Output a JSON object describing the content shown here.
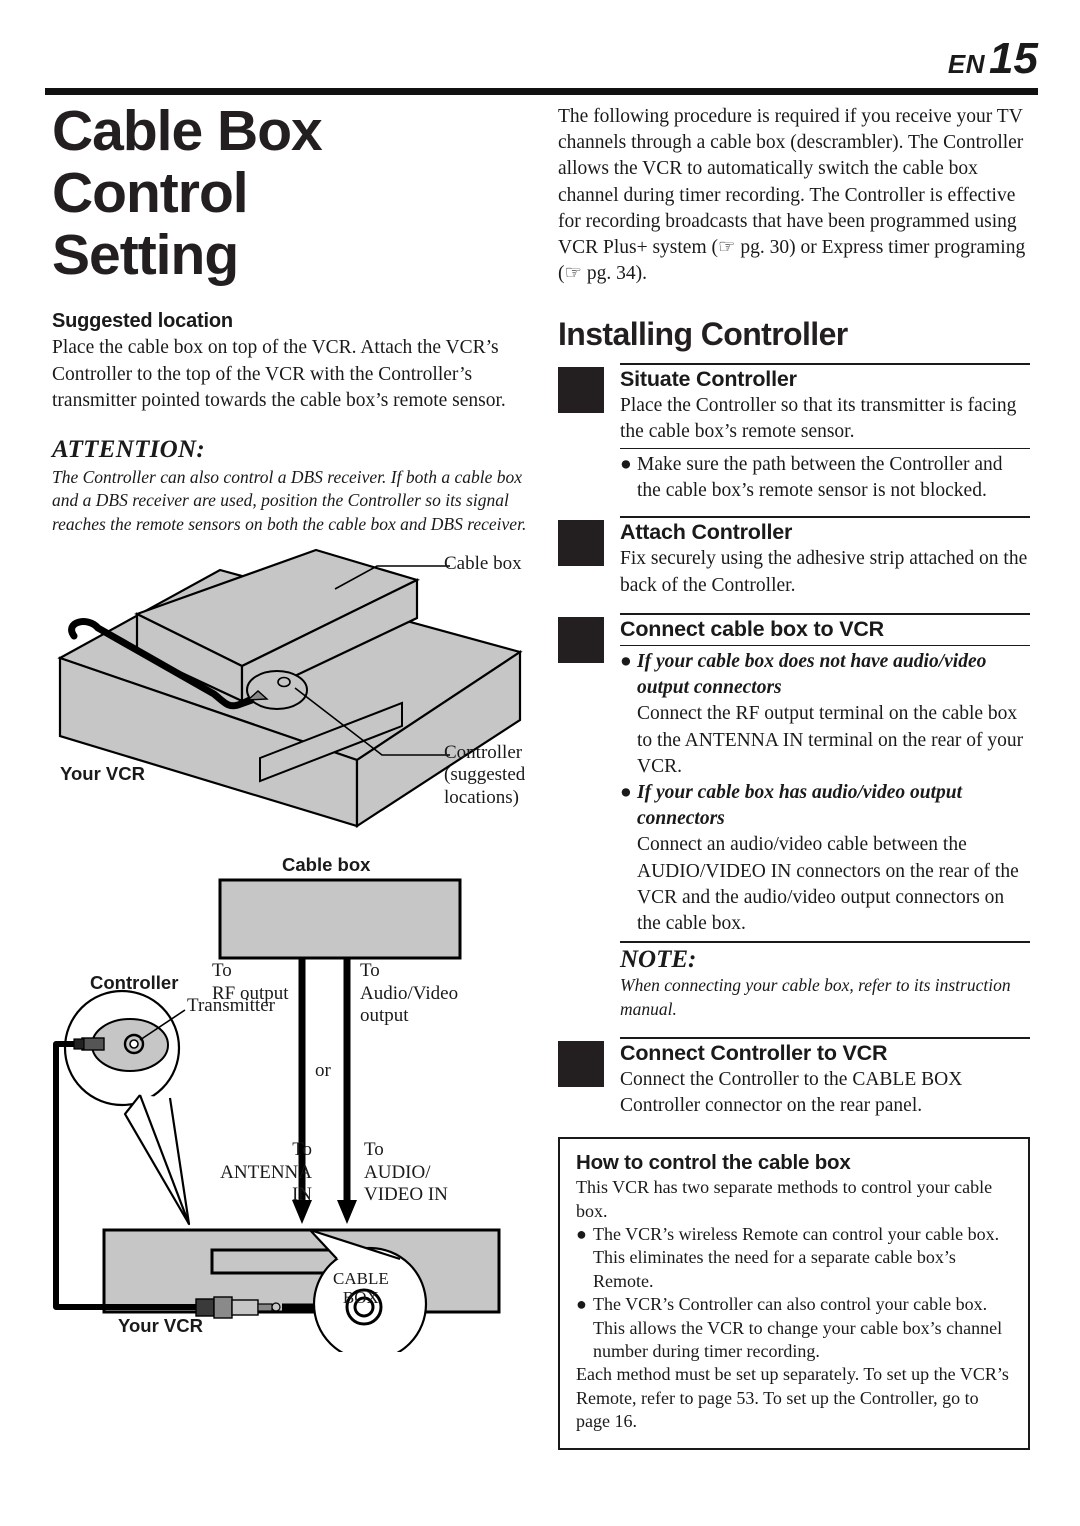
{
  "header": {
    "lang_code": "EN",
    "page_number": "15"
  },
  "left": {
    "title": "Cable Box Control Setting",
    "suggested_location": {
      "heading": "Suggested location",
      "body": "Place the cable box on top of the VCR. Attach the VCR’s Controller to the top of the VCR with the Controller’s transmitter pointed towards the cable box’s remote sensor."
    },
    "attention": {
      "heading": "ATTENTION:",
      "body": "The Controller can also control a DBS receiver. If both a cable box and a DBS receiver are used, position the Controller so its signal reaches the remote sensors on both the cable box and DBS receiver."
    },
    "figure_iso": {
      "label_cable_box": "Cable box",
      "label_controller_line1": "Controller",
      "label_controller_line2": "(suggested",
      "label_controller_line3": "locations)",
      "label_your_vcr": "Your VCR"
    },
    "figure_wiring": {
      "label_cable_box": "Cable box",
      "label_controller": "Controller",
      "label_transmitter": "Transmitter",
      "label_to_rf_1": "To",
      "label_to_rf_2": "RF output",
      "label_to_av_1": "To",
      "label_to_av_2": "Audio/Video",
      "label_to_av_3": "output",
      "label_or": "or",
      "label_to_ant_1": "To",
      "label_to_ant_2": "ANTENNA",
      "label_to_ant_3": "IN",
      "label_to_avin_1": "To",
      "label_to_avin_2": "AUDIO/",
      "label_to_avin_3": "VIDEO IN",
      "label_your_vcr": "Your VCR",
      "label_jack_1": "CABLE",
      "label_jack_2": "BOX"
    }
  },
  "right": {
    "intro": "The following procedure is required if you receive your TV channels through a cable box (descrambler). The Controller allows the VCR to automatically switch the cable box channel during timer recording. The Controller is effective for recording broadcasts that have been programmed using VCR Plus+ system (☞ pg. 30) or Express timer programing (☞ pg. 34).",
    "section_title": "Installing Controller",
    "steps": [
      {
        "head": "Situate Controller",
        "body": "Place the Controller so that its transmitter is facing the cable box’s remote sensor.",
        "bullets": [
          "Make sure the path between the Controller and the cable box’s remote sensor is not blocked."
        ]
      },
      {
        "head": "Attach Controller",
        "body": "Fix securely using the adhesive strip attached on the back of the Controller.",
        "bullets": []
      },
      {
        "head": "Connect cable box to VCR",
        "sub_a_head": "If your cable box does not have audio/video output connectors",
        "sub_a_body": "Connect the RF output terminal on the cable box to the ANTENNA IN terminal on the rear of your VCR.",
        "sub_b_head": "If your cable box has audio/video output connectors",
        "sub_b_body": "Connect an audio/video cable between the AUDIO/VIDEO IN connectors on the rear of the VCR and the audio/video output connectors on the cable box."
      },
      {
        "head": "Connect Controller to VCR",
        "body": "Connect the Controller to the CABLE BOX Controller connector on the rear panel."
      }
    ],
    "note": {
      "heading": "NOTE:",
      "body": "When connecting your cable box, refer to its instruction manual."
    },
    "info_box": {
      "heading": "How to control the cable box",
      "intro": "This VCR has two separate methods to control your cable box.",
      "bullets": [
        "The VCR’s wireless Remote can control your cable box. This eliminates the need for a separate cable box’s Remote.",
        "The VCR’s Controller can also control your cable box. This allows the VCR to change your cable box’s channel number during timer recording."
      ],
      "closing": "Each method must be set up separately. To set up the VCR’s Remote, refer to page 53. To set up the Controller, go to page 16."
    }
  },
  "colors": {
    "ink": "#1a1a1a",
    "device_fill": "#c6c6c6",
    "device_fill_light": "#cfcfcf"
  }
}
